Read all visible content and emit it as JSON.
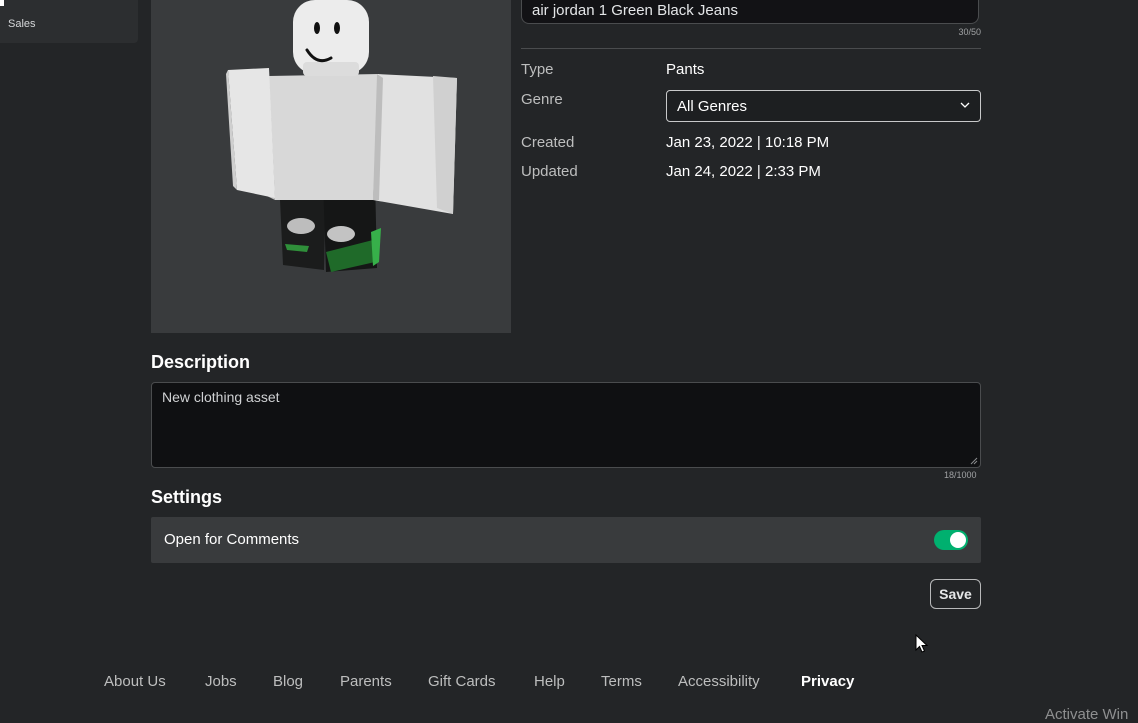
{
  "sidebar": {
    "items": [
      {
        "label": "Sales"
      }
    ]
  },
  "asset": {
    "name": "air jordan 1 Green Black Jeans",
    "name_count": "30/50",
    "type_label": "Type",
    "type_value": "Pants",
    "genre_label": "Genre",
    "genre_value": "All Genres",
    "created_label": "Created",
    "created_value": "Jan 23, 2022 | 10:18 PM",
    "updated_label": "Updated",
    "updated_value": "Jan 24, 2022 | 2:33 PM"
  },
  "description": {
    "title": "Description",
    "value": "New clothing asset",
    "count": "18/1000"
  },
  "settings": {
    "title": "Settings",
    "comments_label": "Open for Comments",
    "comments_enabled": true
  },
  "actions": {
    "save_label": "Save"
  },
  "footer": {
    "links": [
      {
        "label": "About Us"
      },
      {
        "label": "Jobs"
      },
      {
        "label": "Blog"
      },
      {
        "label": "Parents"
      },
      {
        "label": "Gift Cards"
      },
      {
        "label": "Help"
      },
      {
        "label": "Terms"
      },
      {
        "label": "Accessibility"
      },
      {
        "label": "Privacy"
      }
    ]
  },
  "watermark": "Activate Win",
  "colors": {
    "background": "#232527",
    "toggle_on": "#00b06f"
  },
  "icons": {
    "genre_dropdown": "chevron-down-icon",
    "cursor": "mouse-pointer-icon"
  }
}
